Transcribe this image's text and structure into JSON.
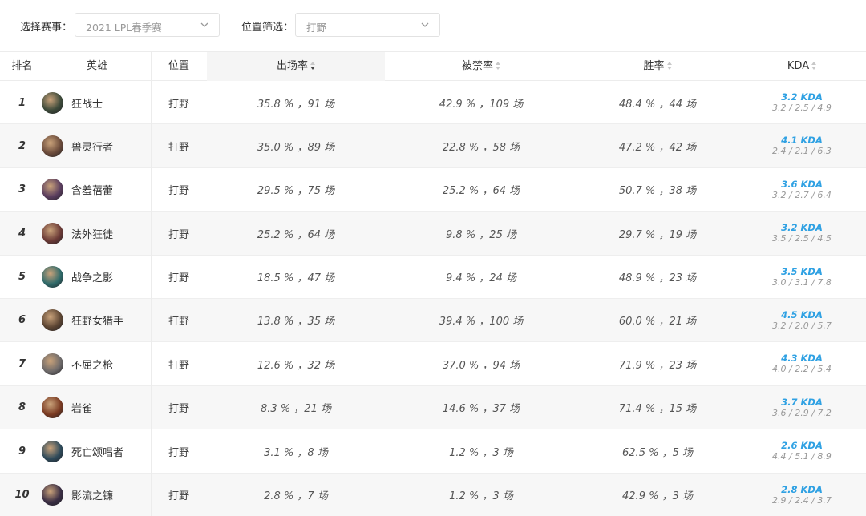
{
  "filters": {
    "event_label": "选择赛事：",
    "event_value": "2021 LPL春季赛",
    "position_label": "位置筛选：",
    "position_value": "打野"
  },
  "columns": {
    "rank": "排名",
    "hero": "英雄",
    "position": "位置",
    "pick_rate": "出场率",
    "ban_rate": "被禁率",
    "win_rate": "胜率",
    "kda": "KDA"
  },
  "sorted_column": "pick_rate",
  "rows": [
    {
      "rank": "1",
      "hero": "狂战士",
      "avatar_color": "#3d4a3a",
      "position": "打野",
      "pick": "35.8 % ，91 场",
      "ban": "42.9 % ，109 场",
      "win": "48.4 % ，44 场",
      "kda": "3.2 KDA",
      "kda_detail": "3.2 / 2.5 / 4.9"
    },
    {
      "rank": "2",
      "hero": "兽灵行者",
      "avatar_color": "#6a4a3a",
      "position": "打野",
      "pick": "35.0 % ，89 场",
      "ban": "22.8 % ，58 场",
      "win": "47.2 % ，42 场",
      "kda": "4.1 KDA",
      "kda_detail": "2.4 / 2.1 / 6.3"
    },
    {
      "rank": "3",
      "hero": "含羞蓓蕾",
      "avatar_color": "#5a3d5e",
      "position": "打野",
      "pick": "29.5 % ，75 场",
      "ban": "25.2 % ，64 场",
      "win": "50.7 % ，38 场",
      "kda": "3.6 KDA",
      "kda_detail": "3.2 / 2.7 / 6.4"
    },
    {
      "rank": "4",
      "hero": "法外狂徒",
      "avatar_color": "#6b3a36",
      "position": "打野",
      "pick": "25.2 % ，64 场",
      "ban": "9.8 % ，25 场",
      "win": "29.7 % ，19 场",
      "kda": "3.2 KDA",
      "kda_detail": "3.5 / 2.5 / 4.5"
    },
    {
      "rank": "5",
      "hero": "战争之影",
      "avatar_color": "#2f6a6a",
      "position": "打野",
      "pick": "18.5 % ，47 场",
      "ban": "9.4 % ，24 场",
      "win": "48.9 % ，23 场",
      "kda": "3.5 KDA",
      "kda_detail": "3.0 / 3.1 / 7.8"
    },
    {
      "rank": "6",
      "hero": "狂野女猎手",
      "avatar_color": "#5b4432",
      "position": "打野",
      "pick": "13.8 % ，35 场",
      "ban": "39.4 % ，100 场",
      "win": "60.0 % ，21 场",
      "kda": "4.5 KDA",
      "kda_detail": "3.2 / 2.0 / 5.7"
    },
    {
      "rank": "7",
      "hero": "不屈之枪",
      "avatar_color": "#6e6a6a",
      "position": "打野",
      "pick": "12.6 % ，32 场",
      "ban": "37.0 % ，94 场",
      "win": "71.9 % ，23 场",
      "kda": "4.3 KDA",
      "kda_detail": "4.0 / 2.2 / 5.4"
    },
    {
      "rank": "8",
      "hero": "岩雀",
      "avatar_color": "#7a3a22",
      "position": "打野",
      "pick": "8.3 % ，21 场",
      "ban": "14.6 % ，37 场",
      "win": "71.4 % ，15 场",
      "kda": "3.7 KDA",
      "kda_detail": "3.6 / 2.9 / 7.2"
    },
    {
      "rank": "9",
      "hero": "死亡颂唱者",
      "avatar_color": "#2e4a5a",
      "position": "打野",
      "pick": "3.1 % ，8 场",
      "ban": "1.2 % ，3 场",
      "win": "62.5 % ，5 场",
      "kda": "2.6 KDA",
      "kda_detail": "4.4 / 5.1 / 8.9"
    },
    {
      "rank": "10",
      "hero": "影流之镰",
      "avatar_color": "#3a2e44",
      "position": "打野",
      "pick": "2.8 % ，7 场",
      "ban": "1.2 % ，3 场",
      "win": "42.9 % ，3 场",
      "kda": "2.8 KDA",
      "kda_detail": "2.9 / 2.4 / 3.7"
    }
  ]
}
